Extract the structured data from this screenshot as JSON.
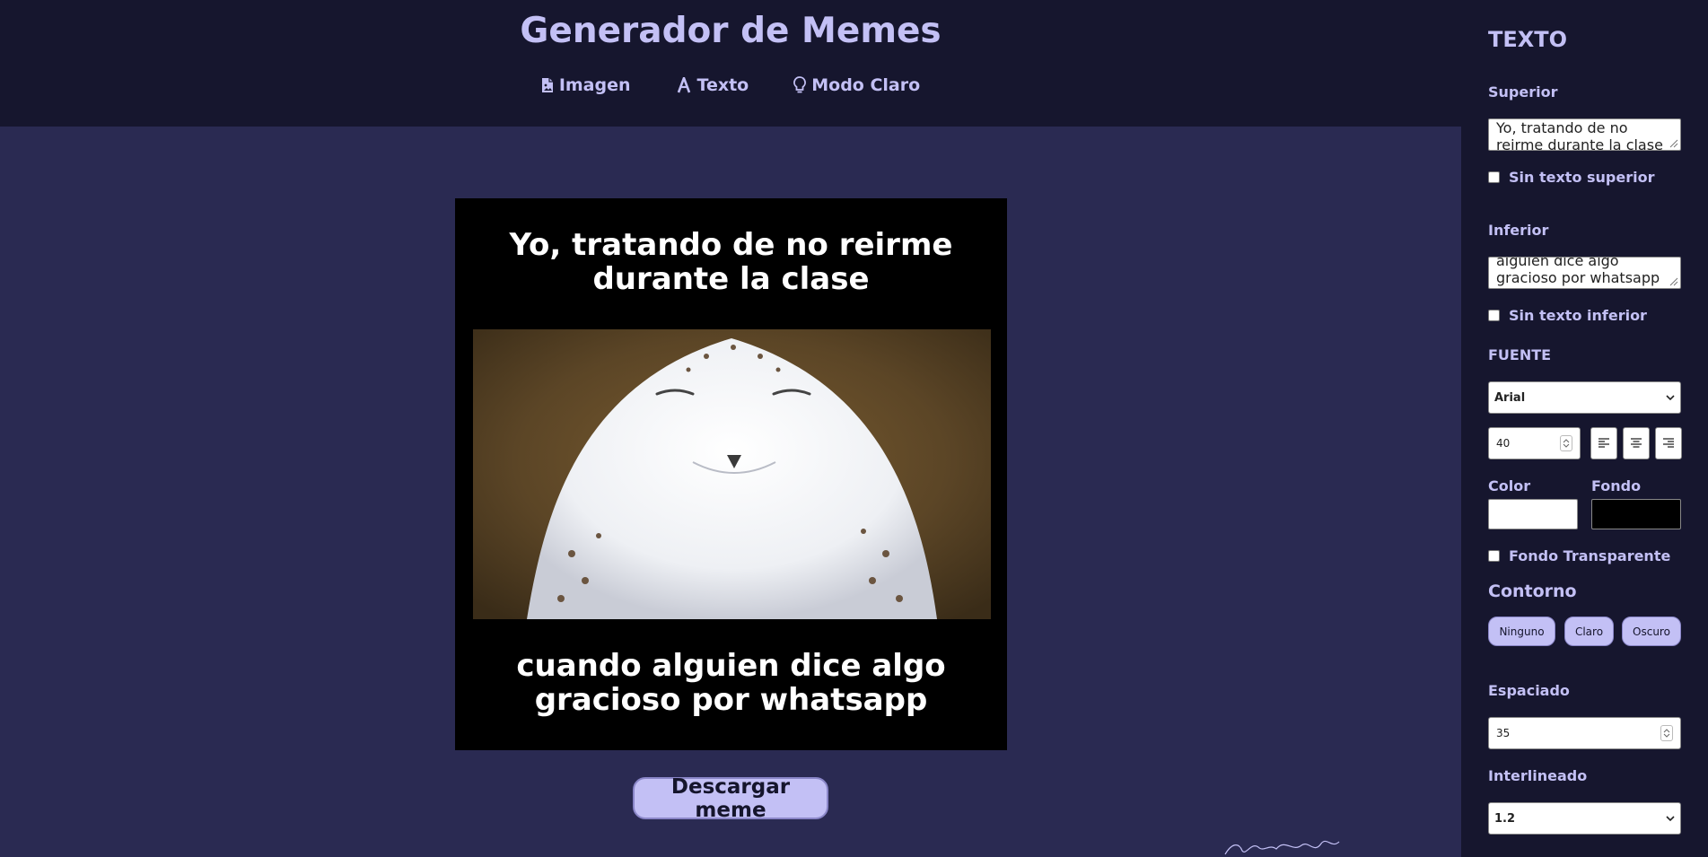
{
  "header": {
    "title": "Generador de Memes",
    "nav": [
      {
        "label": "Imagen",
        "icon": "file-image-icon"
      },
      {
        "label": "Texto",
        "icon": "text-font-icon"
      },
      {
        "label": "Modo Claro",
        "icon": "lightbulb-icon"
      }
    ]
  },
  "meme": {
    "top_text": "Yo, tratando de no reirme durante la clase",
    "bottom_text": "cuando alguien dice algo gracioso por whatsapp",
    "image_subject": "smiling snowy owl photo"
  },
  "download_label": "Descargar meme",
  "panel": {
    "title": "TEXTO",
    "top": {
      "label": "Superior",
      "value": "Yo, tratando de no reirme durante la clase",
      "no_text_label": "Sin texto superior"
    },
    "bottom": {
      "label": "Inferior",
      "value": "alguien dice algo gracioso por whatsapp",
      "no_text_label": "Sin texto inferior"
    },
    "font_section": "FUENTE",
    "font_family": "Arial",
    "font_size": "40",
    "align_icons": [
      "align-left-icon",
      "align-center-icon",
      "align-right-icon"
    ],
    "color_label": "Color",
    "background_label": "Fondo",
    "text_color": "#ffffff",
    "background_color": "#000000",
    "transparent_label": "Fondo Transparente",
    "outline_title": "Contorno",
    "outline_options": [
      "Ninguno",
      "Claro",
      "Oscuro"
    ],
    "spacing_label": "Espaciado",
    "spacing_value": "35",
    "line_height_label": "Interlineado",
    "line_height_value": "1.2"
  },
  "colors": {
    "page_background": "#2a2a52",
    "header_background": "#16162e",
    "accent": "#c3c0f5",
    "button_text": "#15152c"
  }
}
